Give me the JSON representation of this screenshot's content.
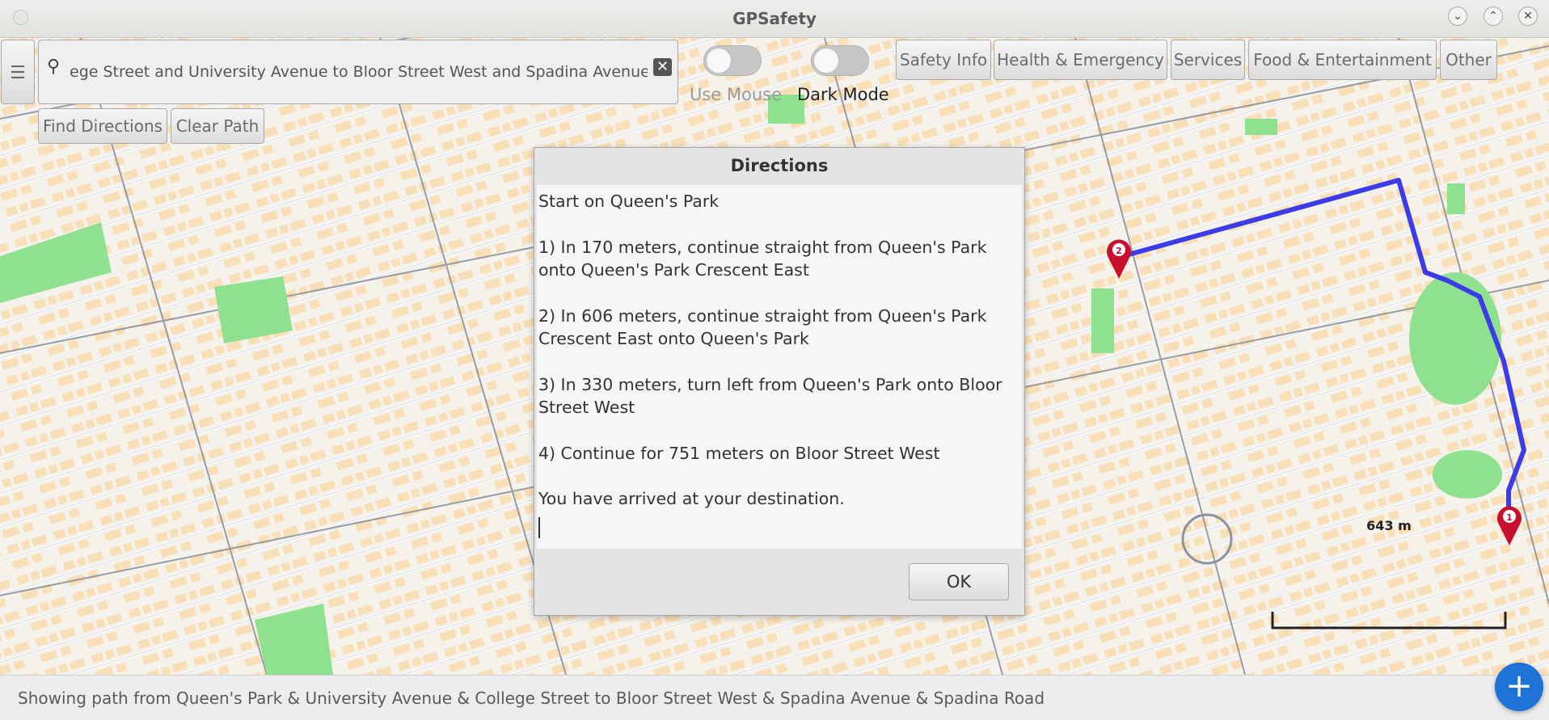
{
  "window": {
    "title": "GPSafety"
  },
  "search": {
    "value": "ege Street and University Avenue to Bloor Street West and Spadina Avenue"
  },
  "toggles": {
    "use_mouse": "Use Mouse",
    "dark_mode": "Dark Mode"
  },
  "buttons": {
    "find_directions": "Find Directions",
    "clear_path": "Clear Path"
  },
  "categories": [
    "Safety Info",
    "Health & Emergency",
    "Services",
    "Food & Entertainment",
    "Other"
  ],
  "dialog": {
    "title": "Directions",
    "lines": [
      "Start on Queen's Park",
      "1) In 170 meters, continue straight from Queen's Park onto Queen's Park Crescent East",
      "2) In 606 meters, continue straight from Queen's Park Crescent East onto Queen's Park",
      "3) In 330 meters, turn left from Queen's Park onto Bloor Street West",
      "4) Continue for 751 meters on Bloor Street West",
      "You have arrived at your destination."
    ],
    "ok_label": "OK"
  },
  "map": {
    "scale_label": "643 m",
    "markers": {
      "start": "1",
      "end": "2"
    },
    "colors": {
      "route": "#3b3be8",
      "marker": "#c8102e",
      "building": "#f9dfb8",
      "park": "#8fe08f"
    }
  },
  "status": {
    "text": "Showing path from Queen's Park & University Avenue & College Street to Bloor Street West & Spadina Avenue & Spadina Road"
  },
  "fab": {
    "label": "+"
  }
}
